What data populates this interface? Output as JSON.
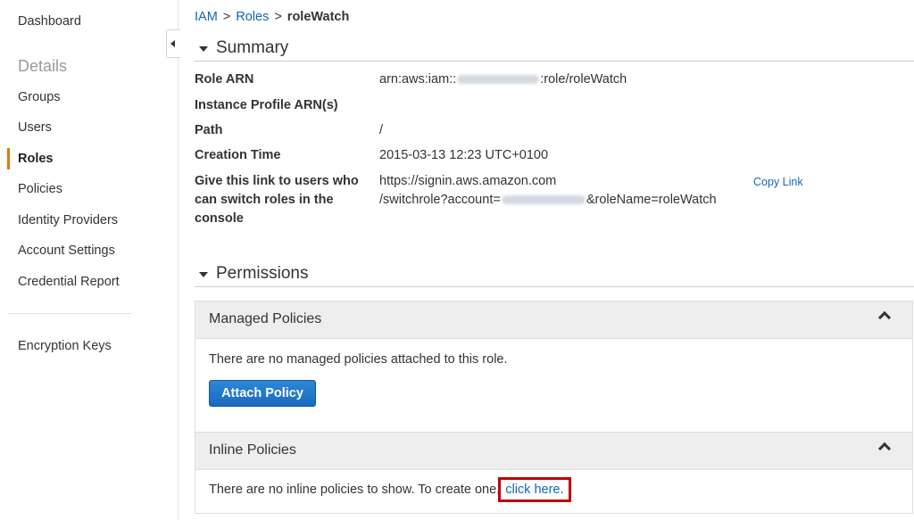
{
  "sidebar": {
    "dashboard": "Dashboard",
    "section": "Details",
    "items": [
      {
        "label": "Groups"
      },
      {
        "label": "Users"
      },
      {
        "label": "Roles"
      },
      {
        "label": "Policies"
      },
      {
        "label": "Identity Providers"
      },
      {
        "label": "Account Settings"
      },
      {
        "label": "Credential Report"
      }
    ],
    "active_item": "Roles",
    "encryption": "Encryption Keys",
    "accent_color": "#e07b00"
  },
  "breadcrumb": {
    "items": [
      {
        "label": "IAM"
      },
      {
        "label": "Roles"
      }
    ],
    "separator": ">",
    "current": "roleWatch"
  },
  "summary": {
    "title": "Summary",
    "role_arn_label": "Role ARN",
    "role_arn_prefix": "arn:aws:iam::",
    "role_arn_suffix": ":role/roleWatch",
    "instance_profile_label": "Instance Profile ARN(s)",
    "path_label": "Path",
    "path_value": "/",
    "creation_time_label": "Creation Time",
    "creation_time_value": "2015-03-13 12:23 UTC+0100",
    "switch_link_label": "Give this link to users who can switch roles in the console",
    "switch_link_line1": "https://signin.aws.amazon.com",
    "switch_link_line2_prefix": "/switchrole?account=",
    "switch_link_line2_suffix": "&roleName=roleWatch",
    "copy_link": "Copy Link"
  },
  "permissions": {
    "title": "Permissions",
    "managed": {
      "title": "Managed Policies",
      "message": "There are no managed policies attached to this role.",
      "button": "Attach Policy"
    },
    "inline": {
      "title": "Inline Policies",
      "message": "There are no inline policies to show. To create one,",
      "link": "click here",
      "after_link": "."
    }
  },
  "colors": {
    "link": "#1166bb",
    "primary_button": "#1a6bbf",
    "highlight_box": "#c00000"
  }
}
